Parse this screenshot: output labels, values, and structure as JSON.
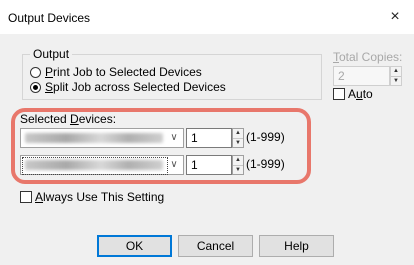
{
  "window": {
    "title": "Output Devices",
    "close_label": "×"
  },
  "output_group": {
    "label": "Output",
    "options": [
      {
        "label": "Print Job to Selected Devices",
        "checked": false
      },
      {
        "label": "Split Job across Selected Devices",
        "checked": true
      }
    ]
  },
  "total_copies": {
    "label": "Total Copies:",
    "value": "2"
  },
  "auto": {
    "label": "Auto",
    "checked": false
  },
  "selected_devices": {
    "label": "Selected Devices:",
    "rows": [
      {
        "copies": "1",
        "range": "(1-999)"
      },
      {
        "copies": "1",
        "range": "(1-999)"
      }
    ]
  },
  "always_use": {
    "label": "Always Use This Setting",
    "checked": false
  },
  "buttons": {
    "ok": "OK",
    "cancel": "Cancel",
    "help": "Help"
  },
  "colors": {
    "highlight": "#e8776b",
    "client_bg": "#f0f0f0",
    "focus_border": "#0078d7"
  }
}
